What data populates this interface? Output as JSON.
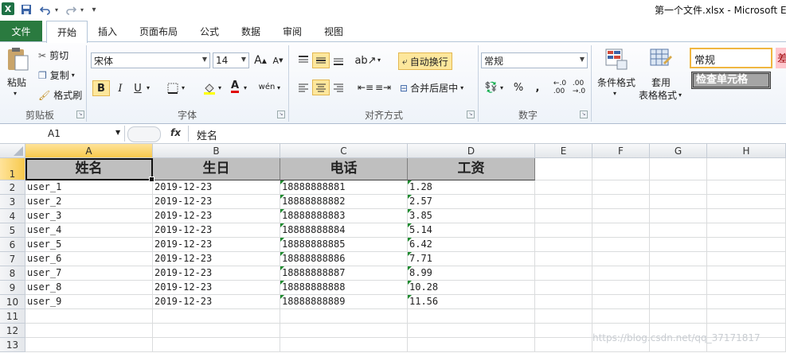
{
  "app": {
    "title": "第一个文件.xlsx - Microsoft E"
  },
  "qat": {
    "logo": "X",
    "save_icon": "save-icon",
    "undo_icon": "undo-icon",
    "redo_icon": "redo-icon"
  },
  "tabs": [
    {
      "label": "文件"
    },
    {
      "label": "开始"
    },
    {
      "label": "插入"
    },
    {
      "label": "页面布局"
    },
    {
      "label": "公式"
    },
    {
      "label": "数据"
    },
    {
      "label": "审阅"
    },
    {
      "label": "视图"
    }
  ],
  "clipboard": {
    "paste": "粘贴",
    "cut": "剪切",
    "copy": "复制",
    "format_painter": "格式刷",
    "group": "剪贴板"
  },
  "font": {
    "name": "宋体",
    "size": "14",
    "group": "字体",
    "bold": "B",
    "italic": "I",
    "underline": "U",
    "grow": "A",
    "shrink": "A",
    "wen": "wén"
  },
  "alignment": {
    "wrap": "自动换行",
    "merge": "合并后居中",
    "group": "对齐方式"
  },
  "number": {
    "format": "常规",
    "percent": "%",
    "comma": ",",
    "group": "数字"
  },
  "styles": {
    "conditional": "条件格式",
    "table_format_1": "套用",
    "table_format_2": "表格格式",
    "style_normal": "常规",
    "style_check": "检查单元格",
    "style_bad": "差"
  },
  "formula_bar": {
    "name_box": "A1",
    "fx": "fx",
    "value": "姓名"
  },
  "columns": [
    "A",
    "B",
    "C",
    "D",
    "E",
    "F",
    "G",
    "H"
  ],
  "rows": [
    "1",
    "2",
    "3",
    "4",
    "5",
    "6",
    "7",
    "8",
    "9",
    "10",
    "11",
    "12",
    "13"
  ],
  "table": {
    "headers": [
      "姓名",
      "生日",
      "电话",
      "工资"
    ],
    "data": [
      [
        "user_1",
        "2019-12-23",
        "18888888881",
        "1.28"
      ],
      [
        "user_2",
        "2019-12-23",
        "18888888882",
        "2.57"
      ],
      [
        "user_3",
        "2019-12-23",
        "18888888883",
        "3.85"
      ],
      [
        "user_4",
        "2019-12-23",
        "18888888884",
        "5.14"
      ],
      [
        "user_5",
        "2019-12-23",
        "18888888885",
        "6.42"
      ],
      [
        "user_6",
        "2019-12-23",
        "18888888886",
        "7.71"
      ],
      [
        "user_7",
        "2019-12-23",
        "18888888887",
        "8.99"
      ],
      [
        "user_8",
        "2019-12-23",
        "18888888888",
        "10.28"
      ],
      [
        "user_9",
        "2019-12-23",
        "18888888889",
        "11.56"
      ]
    ]
  },
  "watermark": "https://blog.csdn.net/qq_37171817",
  "colors": {
    "file_tab": "#2a7a3f",
    "header_fill": "#bfbfbf",
    "selected_header": "#f7c94c",
    "error_triangle": "#1f8b2f"
  }
}
